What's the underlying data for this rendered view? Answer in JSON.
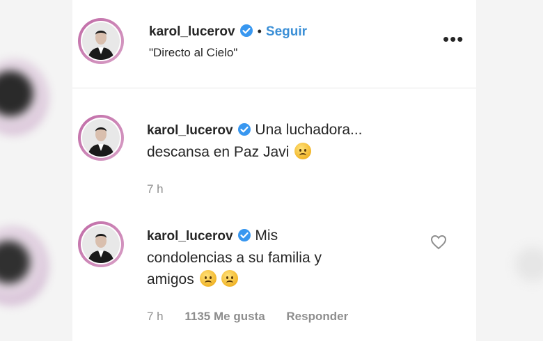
{
  "post": {
    "username": "karol_lucerov",
    "follow_label": "Seguir",
    "separator": "•",
    "bio": "\"Directo al Cielo\"",
    "more_label": "•••"
  },
  "comments": [
    {
      "username": "karol_lucerov",
      "text_line1": "Una luchadora...",
      "text_line2": "descansa en Paz Javi",
      "emoji_count": 1,
      "time": "7 h"
    },
    {
      "username": "karol_lucerov",
      "text_line1": "Mis",
      "text_line2": "condolencias a su familia y",
      "text_line3": "amigos",
      "emoji_count": 2,
      "time": "7 h",
      "likes": "1135 Me gusta",
      "reply_label": "Responder"
    }
  ],
  "colors": {
    "accent": "#3b8fd6",
    "verified": "#3897f0",
    "muted": "#8e8e8e",
    "story_ring": "#c06aa6"
  },
  "icons": [
    "verified-badge-icon",
    "more-options-icon",
    "heart-icon",
    "sad-face-emoji"
  ]
}
